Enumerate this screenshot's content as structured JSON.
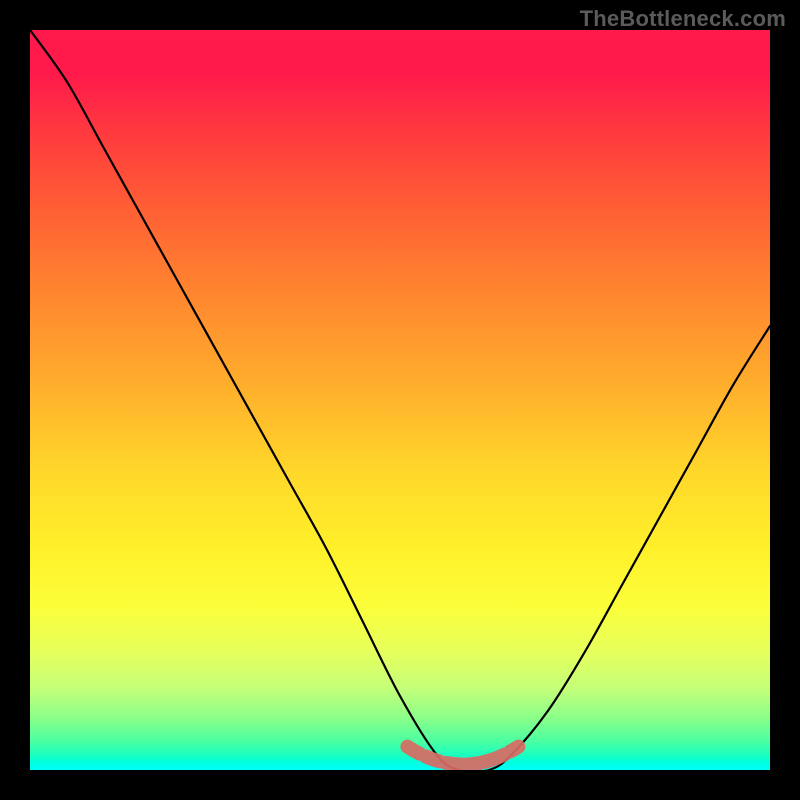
{
  "watermark": "TheBottleneck.com",
  "chart_data": {
    "type": "line",
    "title": "",
    "xlabel": "",
    "ylabel": "",
    "xlim": [
      0,
      100
    ],
    "ylim": [
      0,
      100
    ],
    "grid": false,
    "legend": false,
    "series": [
      {
        "name": "bottleneck-curve",
        "x": [
          0,
          5,
          10,
          15,
          20,
          25,
          30,
          35,
          40,
          45,
          50,
          55,
          58,
          62,
          65,
          70,
          75,
          80,
          85,
          90,
          95,
          100
        ],
        "values": [
          100,
          93,
          84,
          75,
          66,
          57,
          48,
          39,
          30,
          20,
          10,
          2,
          0,
          0,
          2,
          8,
          16,
          25,
          34,
          43,
          52,
          60
        ]
      }
    ],
    "annotations": [
      {
        "name": "sweet-spot",
        "x_range": [
          51,
          66
        ],
        "y": 1,
        "color": "#d96a63"
      }
    ],
    "background_gradient": {
      "orientation": "vertical",
      "stops": [
        {
          "pos": 0.0,
          "color": "#ff1a4b"
        },
        {
          "pos": 0.35,
          "color": "#ff842f"
        },
        {
          "pos": 0.6,
          "color": "#ffd82a"
        },
        {
          "pos": 0.8,
          "color": "#fbff3a"
        },
        {
          "pos": 0.93,
          "color": "#8aff8a"
        },
        {
          "pos": 1.0,
          "color": "#00fff9"
        }
      ]
    }
  }
}
